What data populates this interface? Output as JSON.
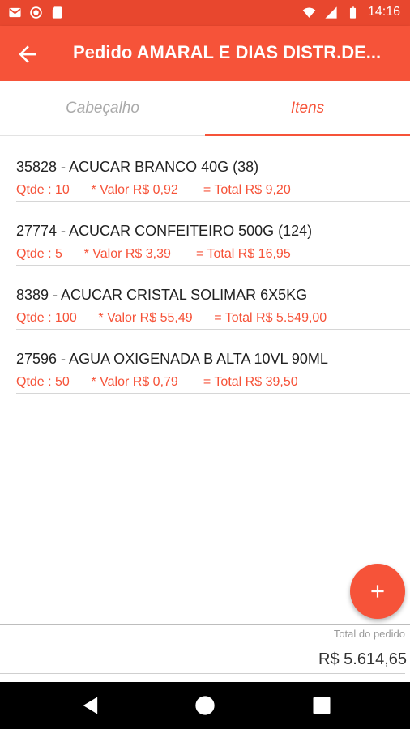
{
  "status_bar": {
    "time": "14:16",
    "left_icons": [
      "gmail-icon",
      "record-icon",
      "sd-card-icon"
    ],
    "right_icons": [
      "wifi-icon",
      "signal-icon",
      "battery-icon"
    ]
  },
  "app_bar": {
    "title": "Pedido AMARAL E DIAS DISTR.DE...",
    "back_icon": "arrow-back-icon"
  },
  "tabs": [
    {
      "label": "Cabeçalho",
      "selected": false
    },
    {
      "label": "Itens",
      "selected": true
    }
  ],
  "items": [
    {
      "name": "35828 - ACUCAR BRANCO 40G (38)",
      "details": "Qtde : 10      * Valor R$ 0,92       = Total R$ 9,20"
    },
    {
      "name": "27774 - ACUCAR CONFEITEIRO 500G (124)",
      "details": "Qtde : 5      * Valor R$ 3,39       = Total R$ 16,95"
    },
    {
      "name": "8389 - ACUCAR CRISTAL SOLIMAR 6X5KG",
      "details": "Qtde : 100      * Valor R$ 55,49      = Total R$ 5.549,00"
    },
    {
      "name": "27596 - AGUA OXIGENADA B ALTA 10VL 90ML",
      "details": "Qtde : 50      * Valor R$ 0,79       = Total R$ 39,50"
    }
  ],
  "fab": {
    "icon": "plus-icon"
  },
  "footer": {
    "label": "Total do pedido",
    "total": "R$ 5.614,65"
  },
  "colors": {
    "status_bar": "#e8472e",
    "primary": "#f65339",
    "tab_inactive": "#aaaaaa"
  },
  "nav_bar": {
    "icons": [
      "back-triangle-icon",
      "home-circle-icon",
      "recents-square-icon"
    ]
  }
}
